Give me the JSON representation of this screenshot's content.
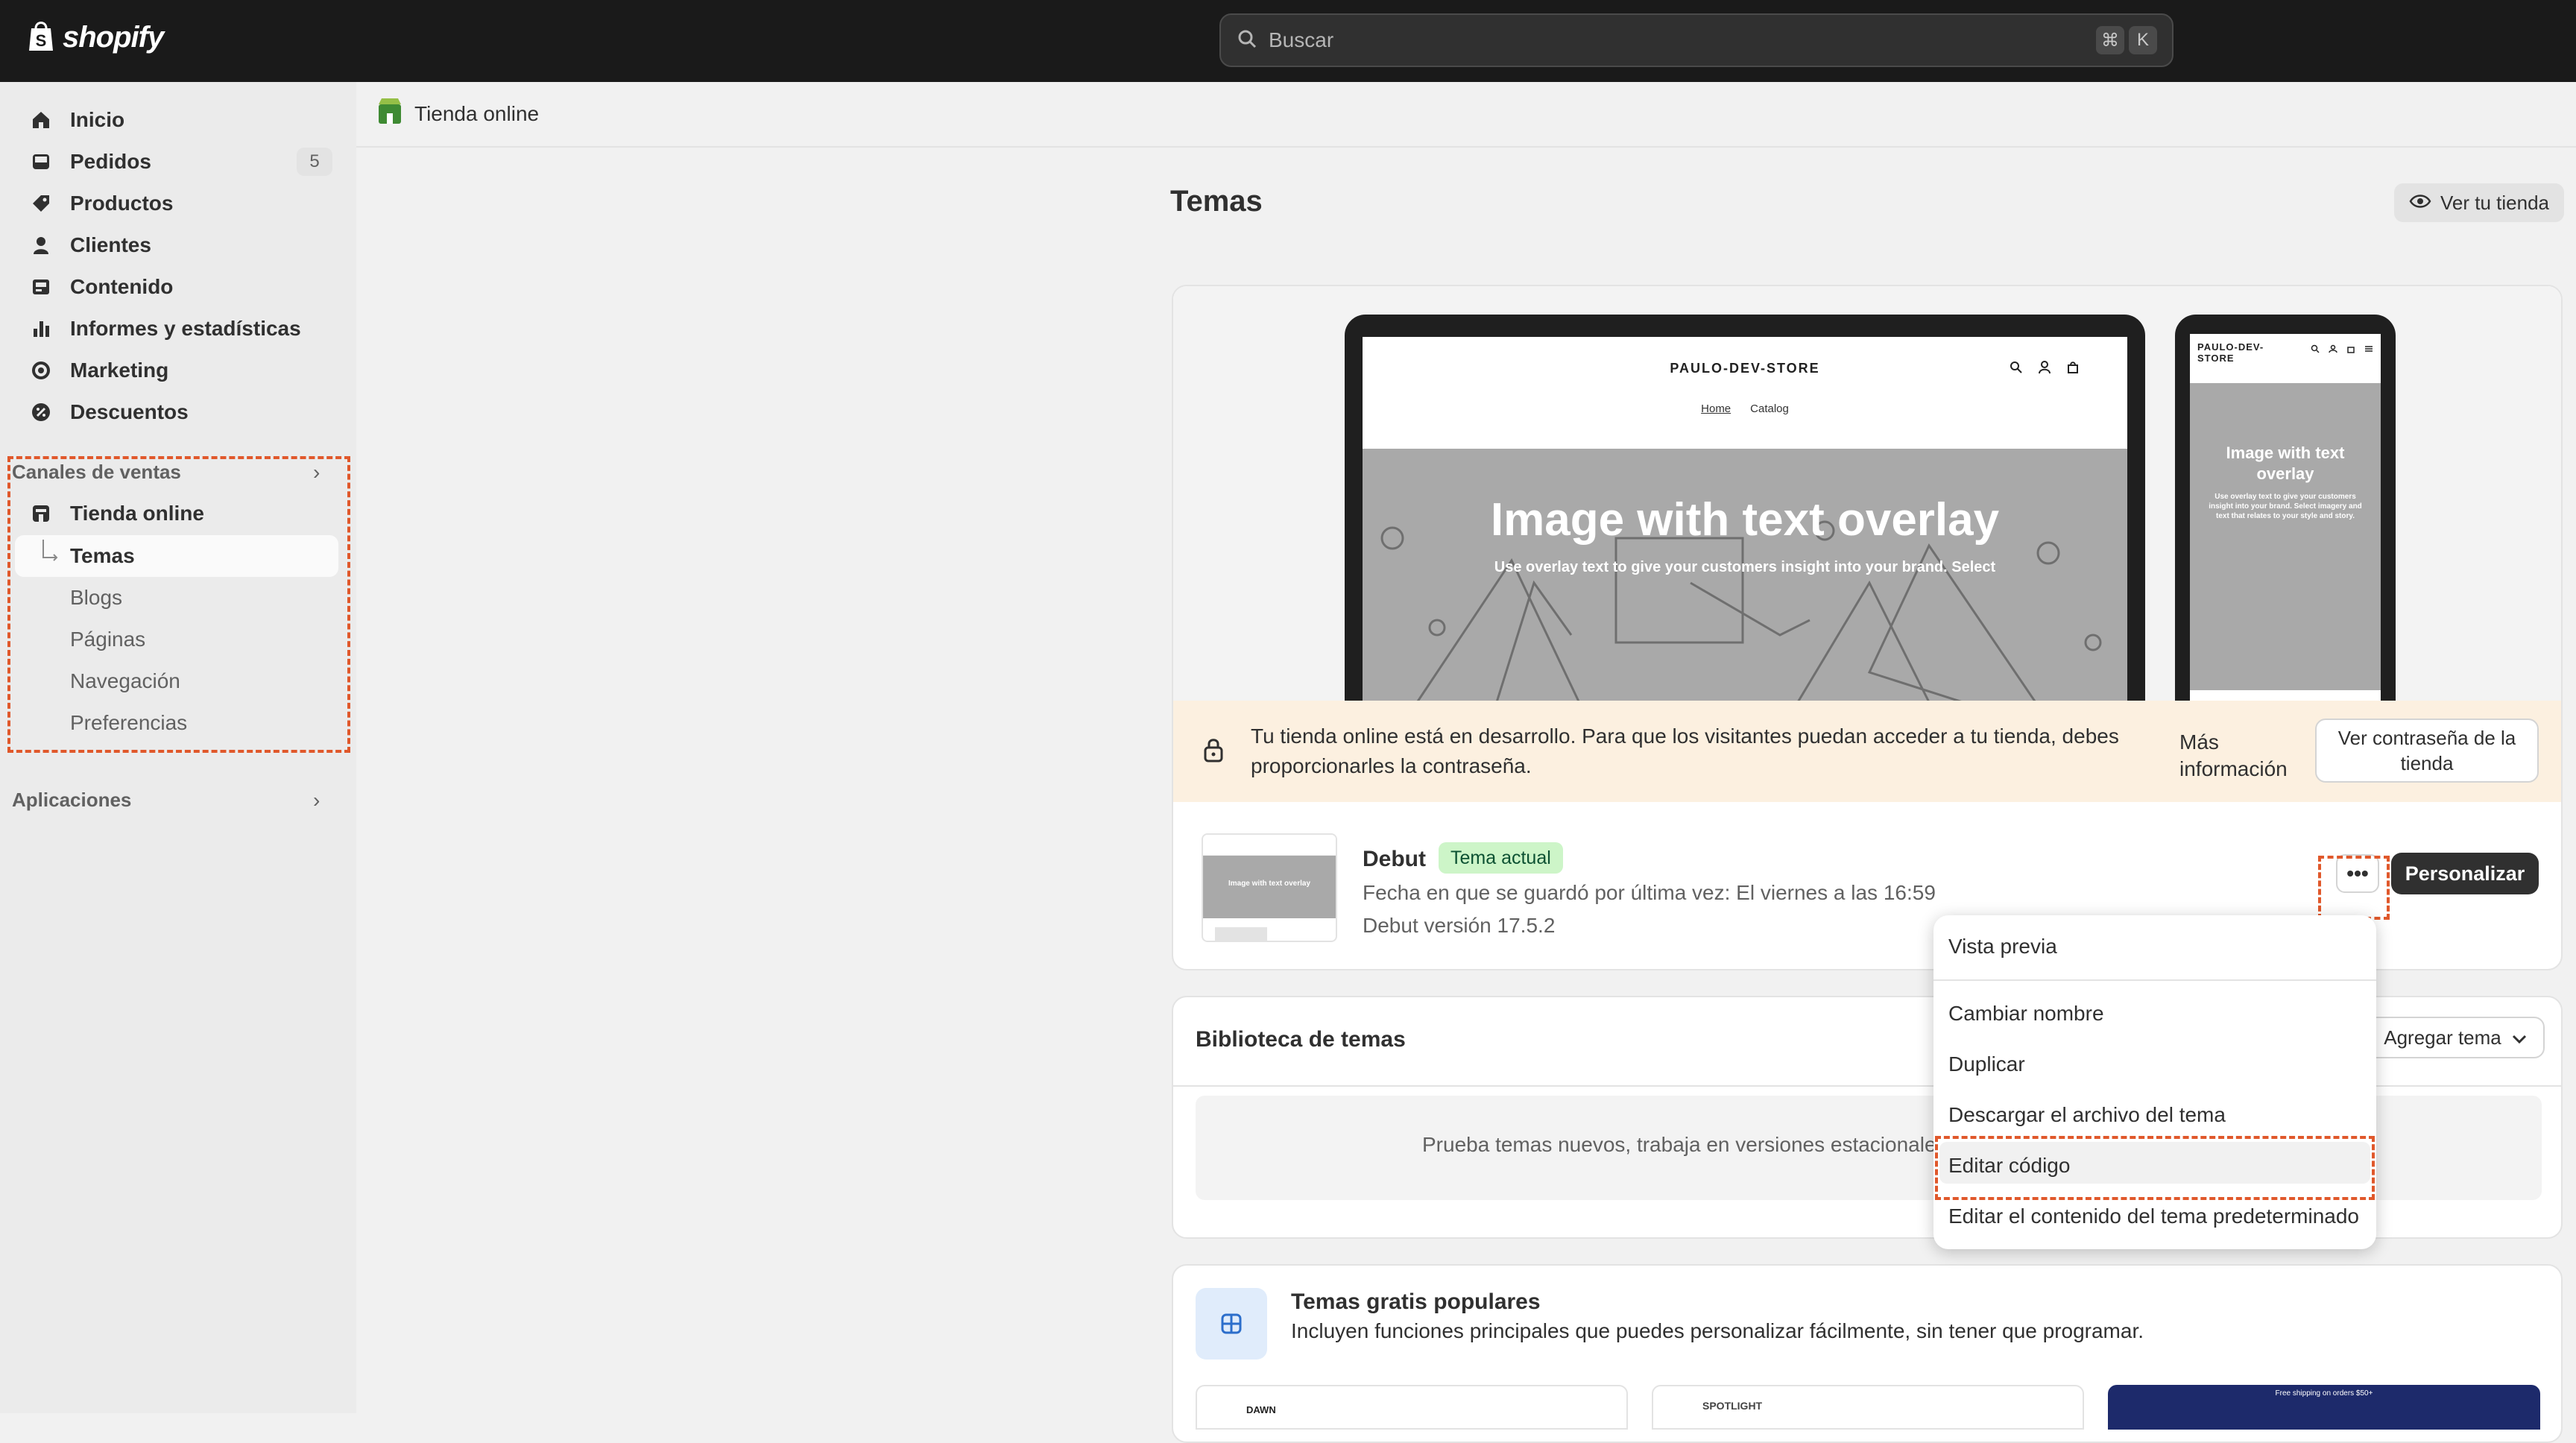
{
  "topbar": {
    "brand": "shopify",
    "search_placeholder": "Buscar",
    "shortcut_keys": [
      "⌘",
      "K"
    ]
  },
  "sidebar": {
    "items": [
      {
        "label": "Inicio",
        "icon": "home-icon"
      },
      {
        "label": "Pedidos",
        "icon": "inbox-icon",
        "badge": "5"
      },
      {
        "label": "Productos",
        "icon": "tag-icon"
      },
      {
        "label": "Clientes",
        "icon": "person-icon"
      },
      {
        "label": "Contenido",
        "icon": "image-icon"
      },
      {
        "label": "Informes y estadísticas",
        "icon": "bar-chart-icon"
      },
      {
        "label": "Marketing",
        "icon": "target-icon"
      },
      {
        "label": "Descuentos",
        "icon": "discount-icon"
      }
    ],
    "sales_channels": {
      "heading": "Canales de ventas",
      "channel": "Tienda online",
      "sub_items": [
        "Temas",
        "Blogs",
        "Páginas",
        "Navegación",
        "Preferencias"
      ],
      "selected": "Temas"
    },
    "apps_heading": "Aplicaciones"
  },
  "breadcrumb": {
    "label": "Tienda online"
  },
  "page": {
    "title": "Temas",
    "view_store_label": "Ver tu tienda"
  },
  "current_theme": {
    "preview": {
      "store_name": "PAULO-DEV-STORE",
      "nav_links": [
        "Home",
        "Catalog"
      ],
      "hero_title": "Image with text overlay",
      "hero_subtitle": "Use overlay text to give your customers insight into your brand. Select",
      "phone_store_name": "PAULO-DEV-\nSTORE",
      "phone_hero_title": "Image with text overlay",
      "phone_hero_subtitle": "Use overlay text to give your customers insight into your brand. Select imagery and text that relates to your style and story."
    },
    "notice": {
      "text": "Tu tienda online está en desarrollo. Para que los visitantes puedan acceder a tu tienda, debes proporcionarles la contraseña.",
      "more_info": "Más información",
      "password_button": "Ver contraseña de la tienda"
    },
    "name": "Debut",
    "tag": "Tema actual",
    "saved_text": "Fecha en que se guardó por última vez: El viernes a las 16:59",
    "version_text": "Debut versión 17.5.2",
    "more_button": "•••",
    "customize_button": "Personalizar"
  },
  "library": {
    "title": "Biblioteca de temas",
    "add_button": "Agregar tema",
    "empty_text": "Prueba temas nuevos, trabaja en versiones estacionales"
  },
  "popular": {
    "title": "Temas gratis populares",
    "subtitle": "Incluyen funciones principales que puedes personalizar fácilmente, sin tener que programar.",
    "theme_previews": [
      "DAWN",
      "SPOTLIGHT",
      "Free shipping on orders $50+"
    ]
  },
  "dropdown": {
    "items": [
      "Vista previa",
      "Cambiar nombre",
      "Duplicar",
      "Descargar el archivo del tema",
      "Editar código",
      "Editar el contenido del tema predeterminado"
    ],
    "highlighted": "Editar código"
  },
  "colors": {
    "topbar": "#1a1a1a",
    "accent_dashed": "#e0582b",
    "badge_green": "#cdf5c8",
    "notice_bg": "#fcf0e0"
  }
}
